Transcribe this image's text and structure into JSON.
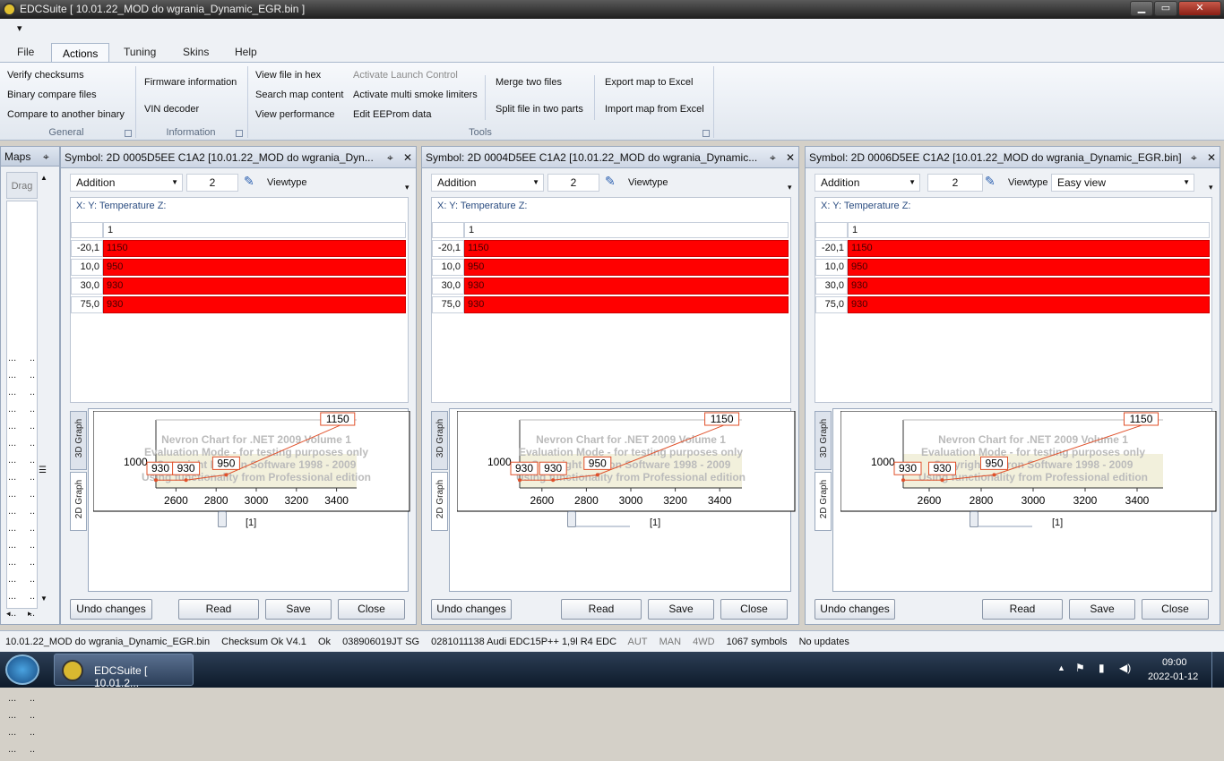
{
  "window": {
    "title": "EDCSuite [ 10.01.22_MOD do wgrania_Dynamic_EGR.bin ]",
    "min": "▁",
    "restore": "▭",
    "close": "✕"
  },
  "quick_access": {
    "arrow": "▾"
  },
  "tabs": [
    "File",
    "Actions",
    "Tuning",
    "Skins",
    "Help"
  ],
  "ribbon": {
    "general": {
      "items": [
        "Verify checksums",
        "Binary compare files",
        "Compare to another binary"
      ],
      "label": "General"
    },
    "information": {
      "items": [
        "Firmware information",
        "VIN decoder"
      ],
      "label": "Information"
    },
    "tools_a": [
      "View file in hex",
      "Search map content",
      "View performance"
    ],
    "tools_b": [
      "Activate Launch Control",
      "Activate multi smoke limiters",
      "Edit EEProm data"
    ],
    "tools_c": [
      "Merge two files",
      "Split file in two parts"
    ],
    "tools_d": [
      "Export map to Excel",
      "Import map from Excel"
    ],
    "tools_label": "Tools"
  },
  "maps_pane": {
    "title": "Maps",
    "pin": "⌖",
    "drag": "Drag",
    "row": "...",
    "col2": "..",
    "up": "▲",
    "down": "▼",
    "left": "◂",
    "right": "▸",
    "menu": "☰"
  },
  "panels": [
    {
      "title": "Symbol: 2D 0005D5EE C1A2 [10.01.22_MOD do wgrania_Dyn...",
      "op": "Addition",
      "val": "2",
      "viewtype_label": "Viewtype",
      "viewtype": ""
    },
    {
      "title": "Symbol: 2D 0004D5EE C1A2 [10.01.22_MOD do wgrania_Dynamic...",
      "op": "Addition",
      "val": "2",
      "viewtype_label": "Viewtype",
      "viewtype": ""
    },
    {
      "title": "Symbol: 2D 0006D5EE C1A2 [10.01.22_MOD do wgrania_Dynamic_EGR.bin]",
      "op": "Addition",
      "val": "2",
      "viewtype_label": "Viewtype",
      "viewtype": "Easy view"
    }
  ],
  "map_table": {
    "axis_caption": "X:  Y: Temperature Z:",
    "column_header": "1",
    "rows": [
      {
        "y": "-20,1",
        "z": "1150"
      },
      {
        "y": "10,0",
        "z": "950"
      },
      {
        "y": "30,0",
        "z": "930"
      },
      {
        "y": "75,0",
        "z": "930"
      }
    ]
  },
  "graph": {
    "tab_3d": "3D Graph",
    "tab_2d": "2D Graph",
    "watermark": [
      "Nevron Chart for .NET 2009 Volume 1",
      "Evaluation Mode - for testing purposes only",
      "Copyright Nevron Software 1998 - 2009",
      "Using functionality from Professional edition"
    ],
    "slider_label": "[1]"
  },
  "chart_data": {
    "type": "line",
    "x_ticks": [
      "2600",
      "2800",
      "3000",
      "3200",
      "3400"
    ],
    "y_tick": "1000",
    "xlim": [
      2500,
      3500
    ],
    "ylim": [
      900,
      1160
    ],
    "series": [
      {
        "x": [
          2500,
          2650,
          2850,
          3450
        ],
        "y": [
          930,
          930,
          950,
          1150
        ],
        "labels": [
          "930",
          "930",
          "950",
          "1150"
        ]
      }
    ],
    "color": "#e0502a"
  },
  "buttons": {
    "undo": "Undo changes",
    "read": "Read",
    "save": "Save",
    "close": "Close"
  },
  "status": [
    "10.01.22_MOD do wgrania_Dynamic_EGR.bin",
    "Checksum Ok V4.1",
    "Ok",
    "038906019JT SG",
    "0281011138 Audi EDC15P++ 1,9l R4 EDC",
    "AUT",
    "MAN",
    "4WD",
    "1067 symbols",
    "No updates"
  ],
  "taskbar": {
    "app": "EDCSuite [ 10.01.2...",
    "time": "09:00",
    "date": "2022-01-12"
  }
}
